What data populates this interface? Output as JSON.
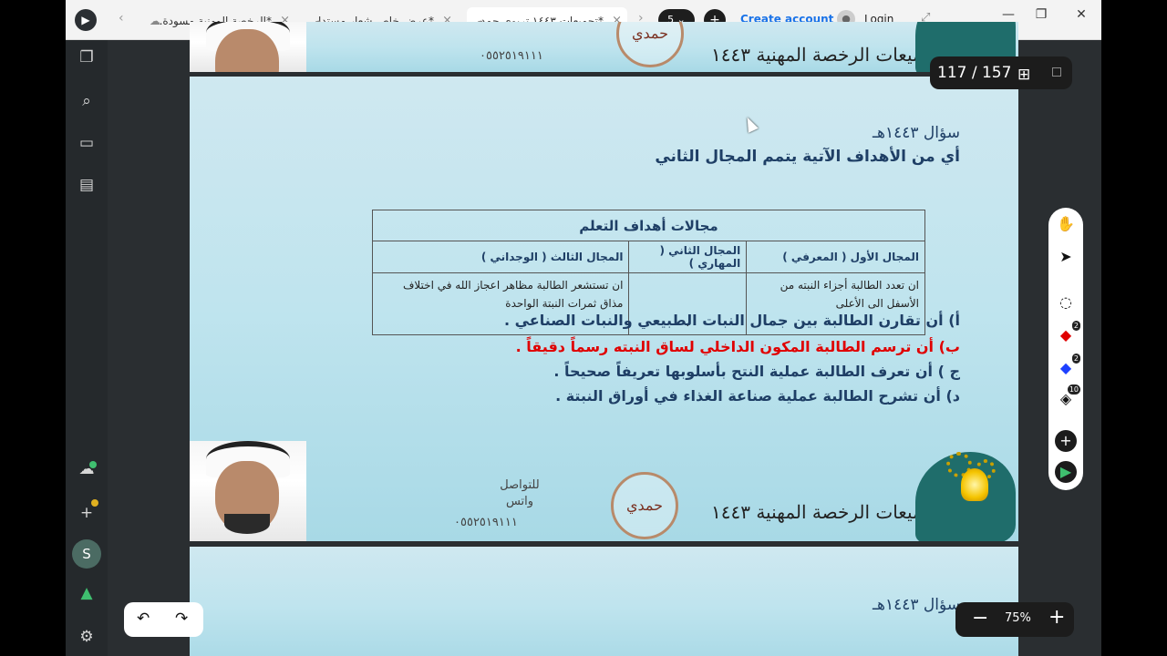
{
  "tabs": [
    {
      "label": "*الرخصة المهنية مسودة...",
      "active": false
    },
    {
      "label": "*عرض خاص شعار مستدا...",
      "active": false
    },
    {
      "label": "*تجميعات ١٤٤٣ تربوي حمد...",
      "active": true
    }
  ],
  "titlebar": {
    "tab_count": "5",
    "create_account": "Create account",
    "login": "Login"
  },
  "pager": {
    "text": "117 / 157"
  },
  "zoom": {
    "value": "75%"
  },
  "slide": {
    "brand": "تجميعات الرخصة المهنية ١٤٤٣",
    "stamp": "حمدي",
    "contact_line1": "للتواصل",
    "contact_line2": "واتس",
    "phone": "٠٥٥٢٥١٩١١١",
    "year": "سؤال ١٤٤٣هـ",
    "question": "أي من الأهداف الآتية يتمم المجال الثاني",
    "table": {
      "title": "مجالات أهداف التعلم",
      "headers": [
        "المجال الأول ( المعرفي )",
        "المجال الثاني ( المهاري )",
        "المجال الثالث ( الوجداني )"
      ],
      "cells": [
        "ان تعدد الطالبة أجزاء النبته من الأسفل الى الأعلى",
        ".",
        "ان تستشعر الطالبة مظاهر اعجاز الله في اختلاف مذاق ثمرات النبتة الواحدة"
      ]
    },
    "options": [
      {
        "text": "أ) أن تقارن الطالبة بين جمال النبات الطبيعي والنبات الصناعي .",
        "correct": false
      },
      {
        "text": "ب) أن ترسم الطالبة المكون الداخلي لساق النبته رسماً دقيقاً .",
        "correct": true
      },
      {
        "text": "ج ) أن تعرف الطالبة عملية النتح بأسلوبها تعريفاً صحيحاً .",
        "correct": false
      },
      {
        "text": "د) أن تشرح الطالبة عملية صناعة الغذاء في أوراق النبتة .",
        "correct": false
      }
    ],
    "next_year": "سؤال ١٤٤٣هـ"
  },
  "tools": {
    "red_count": "2",
    "blue_count": "2",
    "eraser_count": "10"
  },
  "colors": {
    "correct": "#e00000",
    "text_blue": "#1f3f66",
    "accent": "#1a73e8"
  }
}
